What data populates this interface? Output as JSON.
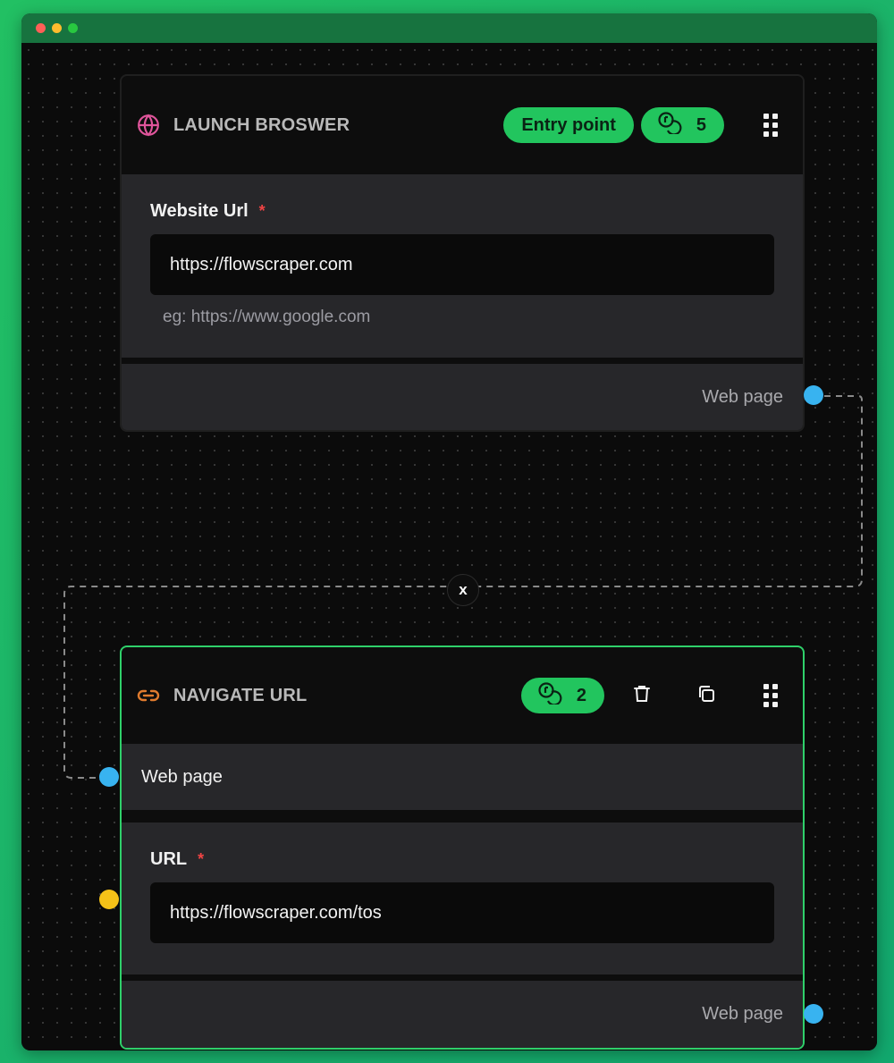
{
  "window": {
    "traffic_lights": [
      "#ff5f57",
      "#febc2e",
      "#28c840"
    ]
  },
  "nodes": {
    "launch_browser": {
      "icon": "globe-icon",
      "title": "LAUNCH BROSWER",
      "entry_badge": "Entry point",
      "credits_icon": "coins-icon",
      "credits": "5",
      "field": {
        "label": "Website Url",
        "required_mark": "*",
        "value": "https://flowscraper.com",
        "hint": "eg: https://www.google.com"
      },
      "output": {
        "label": "Web page"
      }
    },
    "navigate_url": {
      "icon": "link-icon",
      "title": "NAVIGATE URL",
      "credits_icon": "coins-icon",
      "credits": "2",
      "input": {
        "label": "Web page"
      },
      "field": {
        "label": "URL",
        "required_mark": "*",
        "value": "https://flowscraper.com/tos"
      },
      "output": {
        "label": "Web page"
      }
    }
  },
  "edge": {
    "delete_label": "x"
  },
  "colors": {
    "accent": "#22c55e",
    "handle_web_page": "#38b3f0",
    "handle_string": "#f5c218",
    "required": "#ef4444"
  }
}
